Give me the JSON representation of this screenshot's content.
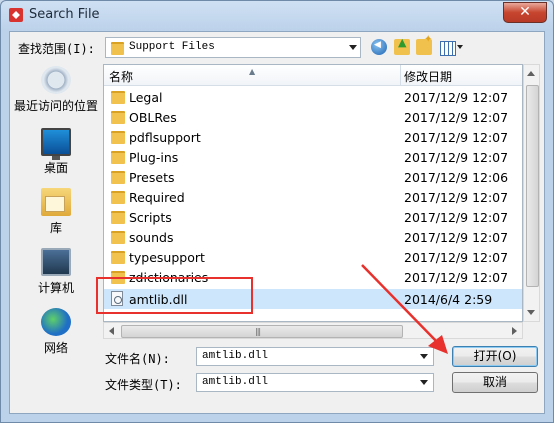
{
  "window": {
    "title": "Search File",
    "close_label": "✕"
  },
  "lookin": {
    "label": "查找范围(I):",
    "value": "Support Files"
  },
  "toolbar": {
    "icons": [
      "back-icon",
      "up-folder-icon",
      "new-folder-icon",
      "view-menu-icon"
    ]
  },
  "places": [
    {
      "label": "最近访问的位置",
      "icon": "recent-places-icon"
    },
    {
      "label": "桌面",
      "icon": "desktop-icon"
    },
    {
      "label": "库",
      "icon": "library-icon"
    },
    {
      "label": "计算机",
      "icon": "computer-icon"
    },
    {
      "label": "网络",
      "icon": "network-icon"
    }
  ],
  "list": {
    "columns": {
      "name": "名称",
      "date": "修改日期"
    },
    "rows": [
      {
        "name": "Legal",
        "date": "2017/12/9 12:07",
        "type": "folder"
      },
      {
        "name": "OBLRes",
        "date": "2017/12/9 12:07",
        "type": "folder"
      },
      {
        "name": "pdflsupport",
        "date": "2017/12/9 12:07",
        "type": "folder"
      },
      {
        "name": "Plug-ins",
        "date": "2017/12/9 12:07",
        "type": "folder"
      },
      {
        "name": "Presets",
        "date": "2017/12/9 12:06",
        "type": "folder"
      },
      {
        "name": "Required",
        "date": "2017/12/9 12:07",
        "type": "folder"
      },
      {
        "name": "Scripts",
        "date": "2017/12/9 12:07",
        "type": "folder"
      },
      {
        "name": "sounds",
        "date": "2017/12/9 12:07",
        "type": "folder"
      },
      {
        "name": "typesupport",
        "date": "2017/12/9 12:07",
        "type": "folder"
      },
      {
        "name": "zdictionaries",
        "date": "2017/12/9 12:07",
        "type": "folder"
      },
      {
        "name": "amtlib.dll",
        "date": "2014/6/4 2:59",
        "type": "file",
        "selected": true
      }
    ],
    "hscroll_grip": "|||"
  },
  "filename": {
    "label": "文件名(N):",
    "value": "amtlib.dll"
  },
  "filetype": {
    "label": "文件类型(T):",
    "value": "amtlib.dll"
  },
  "buttons": {
    "open": "打开(O)",
    "cancel": "取消"
  },
  "colors": {
    "highlight": "#e8302c",
    "selection": "#cde6fb"
  }
}
